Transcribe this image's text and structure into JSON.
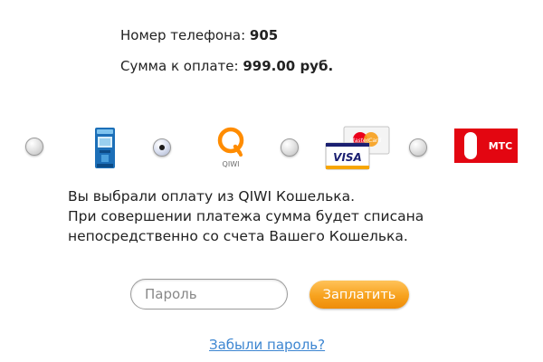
{
  "summary": {
    "phone_label": "Номер телефона:",
    "phone_value": "905",
    "amount_label": "Сумма к оплате:",
    "amount_value": "999.00 руб."
  },
  "methods": [
    {
      "icon": "terminal-icon",
      "selected": false
    },
    {
      "icon": "qiwi-logo-icon",
      "label": "QIWI",
      "selected": true
    },
    {
      "icon": "bank-cards-icon",
      "labels": [
        "MasterCard",
        "VISA"
      ],
      "selected": false
    },
    {
      "icon": "mts-logo-icon",
      "label": "МТС",
      "selected": false
    }
  ],
  "info": {
    "line1": "Вы выбрали оплату из QIWI Кошелька.",
    "line2": "При совершении платежа сумма будет списана",
    "line3": "непосредственно со счета Вашего Кошелька."
  },
  "form": {
    "password_placeholder": "Пароль",
    "pay_label": "Заплатить",
    "forgot_label": "Забыли пароль?"
  },
  "colors": {
    "pay_button": "#f7a21e",
    "link": "#3d86d1",
    "mts_red": "#e30611",
    "qiwi_orange": "#ff8c00"
  }
}
